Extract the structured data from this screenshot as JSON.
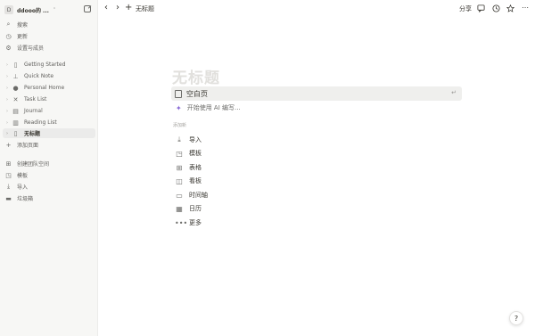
{
  "sidebar": {
    "workspace": {
      "avatar_letter": "D",
      "name": "ddooo的 ...",
      "switch_icon": "chevron-updown-icon",
      "new_page_icon": "compose-icon"
    },
    "top_items": [
      {
        "label": "搜索",
        "icon": "search-icon"
      },
      {
        "label": "更新",
        "icon": "clock-icon"
      },
      {
        "label": "设置与成员",
        "icon": "gear-icon"
      }
    ],
    "pages": [
      {
        "label": "Getting Started",
        "icon": "document-icon"
      },
      {
        "label": "Quick Note",
        "icon": "pin-icon"
      },
      {
        "label": "Personal Home",
        "icon": "person-icon"
      },
      {
        "label": "Task List",
        "icon": "checklist-icon"
      },
      {
        "label": "Journal",
        "icon": "book-icon"
      },
      {
        "label": "Reading List",
        "icon": "book-stack-icon"
      },
      {
        "label": "无标题",
        "icon": "document-icon",
        "active": true
      }
    ],
    "add_page": "添加页面",
    "bottom_items": [
      {
        "label": "创建团队空间",
        "icon": "team-icon"
      },
      {
        "label": "模板",
        "icon": "template-icon"
      },
      {
        "label": "导入",
        "icon": "download-icon"
      },
      {
        "label": "垃圾箱",
        "icon": "trash-icon"
      }
    ]
  },
  "topbar": {
    "breadcrumb": "无标题",
    "share_label": "分享"
  },
  "editor": {
    "title_placeholder": "无标题",
    "blank_page_label": "空白页",
    "enter_hint": "↵",
    "ai_label": "开始使用 AI 编写...",
    "section_label": "添加新",
    "templates": [
      {
        "label": "导入",
        "icon": "download-icon"
      },
      {
        "label": "模板",
        "icon": "template-icon"
      },
      {
        "label": "表格",
        "icon": "table-icon"
      },
      {
        "label": "看板",
        "icon": "board-icon"
      },
      {
        "label": "时间轴",
        "icon": "timeline-icon"
      },
      {
        "label": "日历",
        "icon": "calendar-icon"
      },
      {
        "label": "更多",
        "icon": "more-icon"
      }
    ]
  },
  "help_label": "?",
  "colors": {
    "sidebar_bg": "#f7f7f5",
    "active_bg": "#ebebea",
    "accent_ai": "#8a6bd6",
    "title_placeholder": "#e1e0dd"
  }
}
